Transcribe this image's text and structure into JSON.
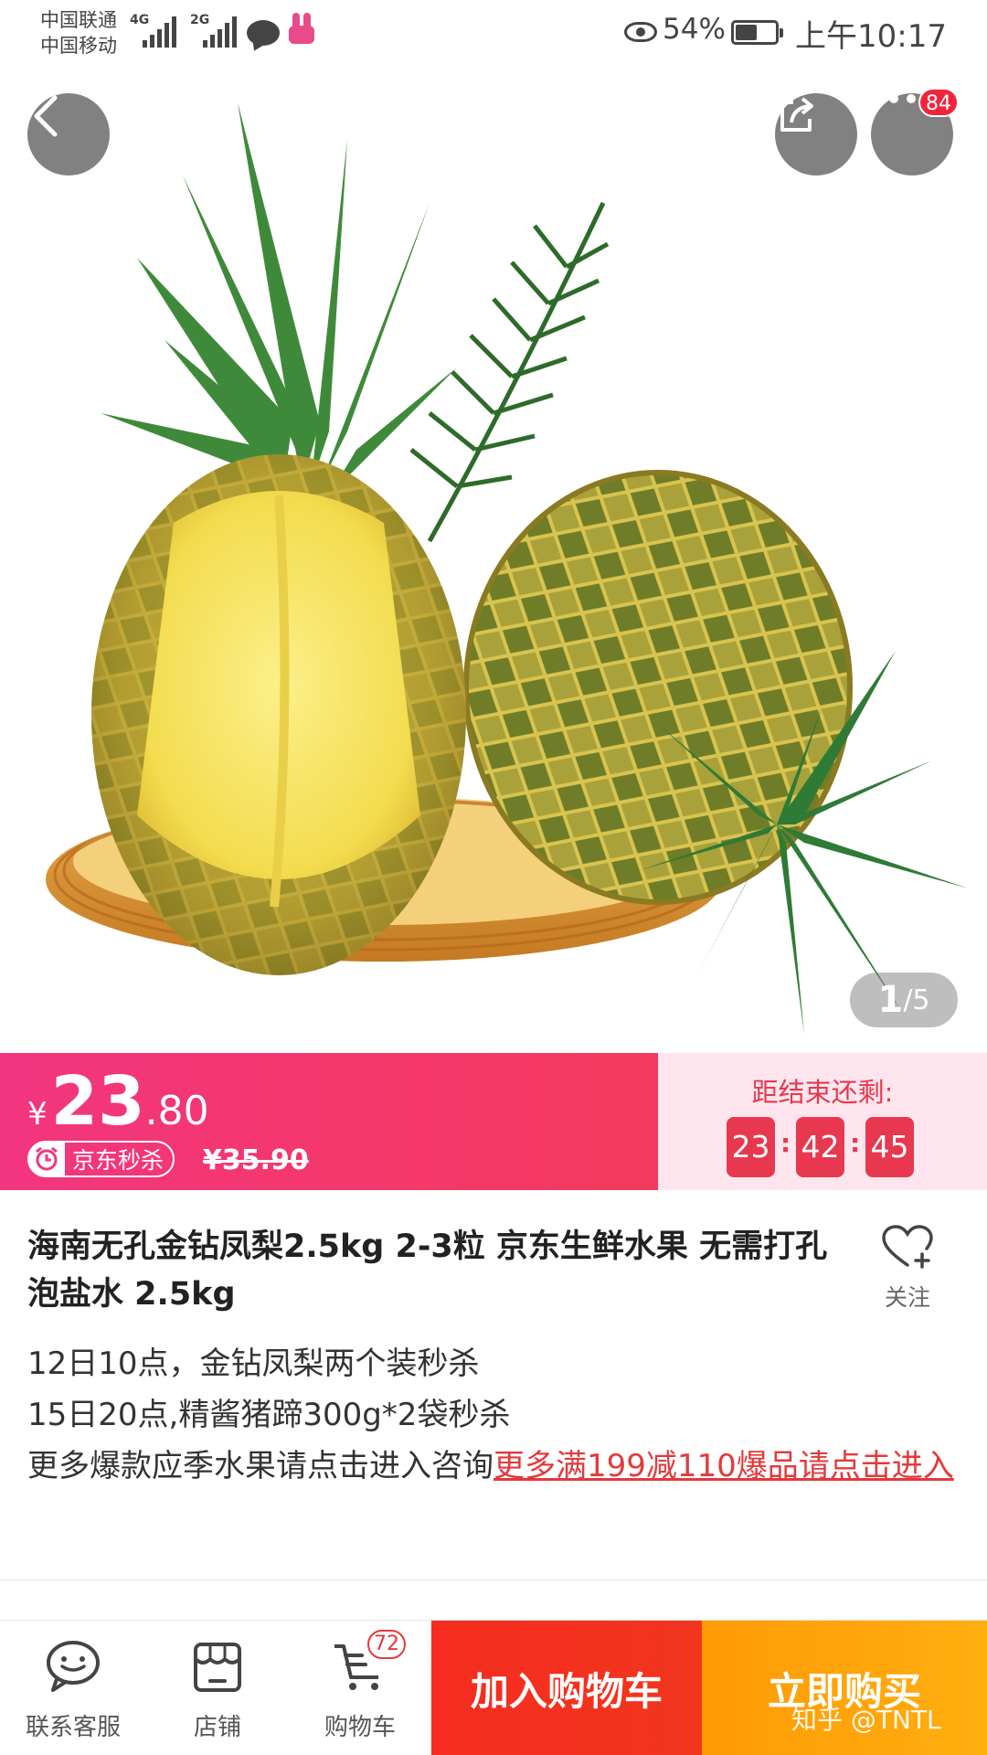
{
  "status_bar": {
    "carrier_1": "中国联通",
    "carrier_2": "中国移动",
    "network_1": "4G",
    "network_2": "2G",
    "battery_percent": "54%",
    "battery_level": 0.54,
    "time": "上午10:17",
    "icons": [
      "eye-icon",
      "chat-icon",
      "rabbit-app-icon"
    ]
  },
  "header": {
    "back_icon": "chevron-left-icon",
    "share_icon": "share-icon",
    "more_icon": "more-icon",
    "more_badge": "84"
  },
  "gallery": {
    "current": "1",
    "total": "/5"
  },
  "price": {
    "currency": "¥",
    "integer": "23",
    "decimal": ".80",
    "seckill_label": "京东秒杀",
    "original_price": "¥35.90"
  },
  "countdown": {
    "label": "距结束还剩:",
    "hours": "23",
    "minutes": "42",
    "seconds": "45",
    "separator": ":"
  },
  "product": {
    "title": "海南无孔金钻凤梨2.5kg 2-3粒  京东生鲜水果 无需打孔泡盐水 2.5kg",
    "follow_label": "关注",
    "promo_line_1": "12日10点，金钻凤梨两个装秒杀",
    "promo_line_2": "15日20点,精酱猪蹄300g*2袋秒杀",
    "promo_line_3": "更多爆款应季水果请点击进入咨询",
    "promo_link": "更多满199减110爆品请点击进入"
  },
  "bottom_bar": {
    "service_label": "联系客服",
    "shop_label": "店铺",
    "cart_label": "购物车",
    "cart_badge": "72",
    "add_to_cart": "加入购物车",
    "buy_now": "立即购买"
  },
  "watermark": "知乎 @TNTL",
  "colors": {
    "brand_red": "#e4393c",
    "price_pink": "#f2357f",
    "countdown_bg": "#ffe6ee",
    "buy_orange": "#ffa00a"
  }
}
